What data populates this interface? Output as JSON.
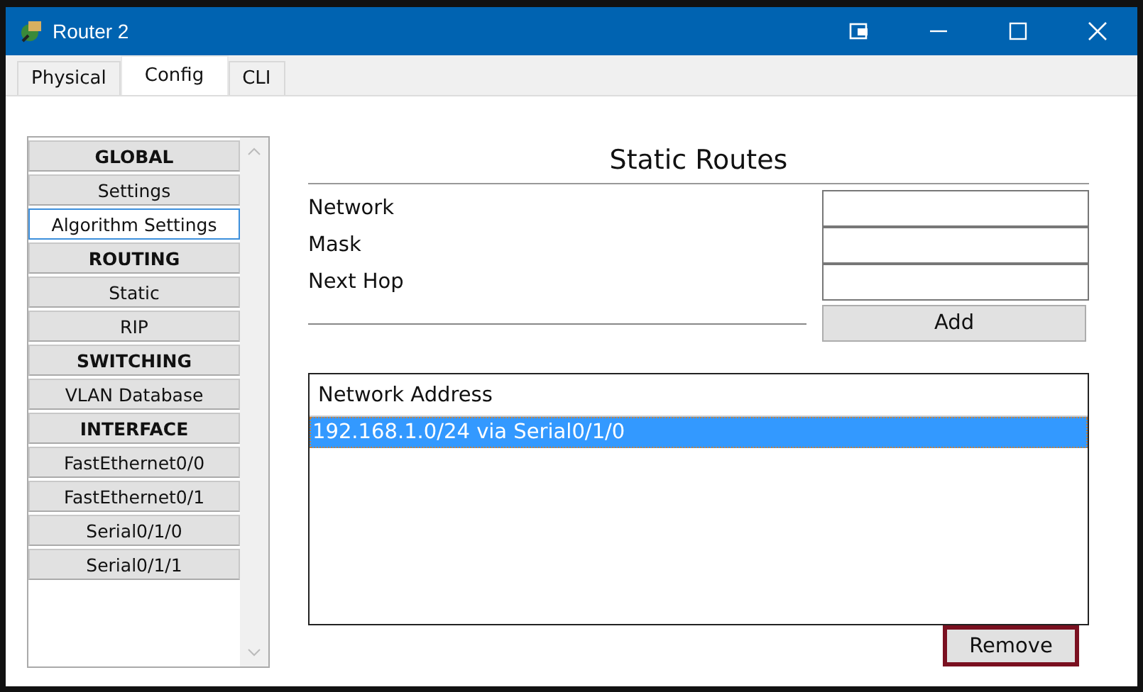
{
  "window": {
    "title": "Router 2"
  },
  "tabs": [
    {
      "label": "Physical",
      "selected": false
    },
    {
      "label": "Config",
      "selected": true
    },
    {
      "label": "CLI",
      "selected": false
    }
  ],
  "sidebar": {
    "items": [
      {
        "label": "GLOBAL",
        "kind": "heading",
        "selected": false
      },
      {
        "label": "Settings",
        "kind": "item",
        "selected": false
      },
      {
        "label": "Algorithm Settings",
        "kind": "item",
        "selected": true
      },
      {
        "label": "ROUTING",
        "kind": "heading",
        "selected": false
      },
      {
        "label": "Static",
        "kind": "item",
        "selected": false
      },
      {
        "label": "RIP",
        "kind": "item",
        "selected": false
      },
      {
        "label": "SWITCHING",
        "kind": "heading",
        "selected": false
      },
      {
        "label": "VLAN Database",
        "kind": "item",
        "selected": false
      },
      {
        "label": "INTERFACE",
        "kind": "heading",
        "selected": false
      },
      {
        "label": "FastEthernet0/0",
        "kind": "item",
        "selected": false
      },
      {
        "label": "FastEthernet0/1",
        "kind": "item",
        "selected": false
      },
      {
        "label": "Serial0/1/0",
        "kind": "item",
        "selected": false
      },
      {
        "label": "Serial0/1/1",
        "kind": "item",
        "selected": false
      }
    ]
  },
  "static_routes": {
    "title": "Static Routes",
    "fields": [
      {
        "label": "Network"
      },
      {
        "label": "Mask"
      },
      {
        "label": "Next Hop"
      }
    ],
    "add_button": "Add",
    "list": {
      "header": "Network Address",
      "rows": [
        {
          "text": "192.168.1.0/24 via Serial0/1/0",
          "selected": true
        }
      ]
    },
    "remove_button": "Remove"
  }
}
